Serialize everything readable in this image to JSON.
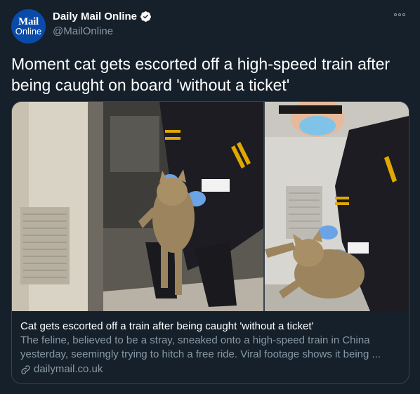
{
  "author": {
    "avatar_line1": "Mail",
    "avatar_line2": "Online",
    "display_name": "Daily Mail Online",
    "handle": "@MailOnline",
    "verified_icon": "verified-badge-icon"
  },
  "tweet": {
    "text": "Moment cat gets escorted off a high-speed train after being caught on board 'without a ticket'"
  },
  "card": {
    "title": "Cat gets escorted off a train after being caught 'without a ticket'",
    "description": "The feline, believed to be a stray, sneaked onto a high-speed train in China yesterday, seemingly trying to hitch a free ride. Viral footage shows it being ...",
    "domain": "dailymail.co.uk",
    "domain_icon": "link-icon"
  },
  "colors": {
    "background": "#15202b",
    "border": "#38444d",
    "secondary_text": "#8899a6",
    "verified": "#ffffff",
    "avatar": "#0a4aa8"
  }
}
